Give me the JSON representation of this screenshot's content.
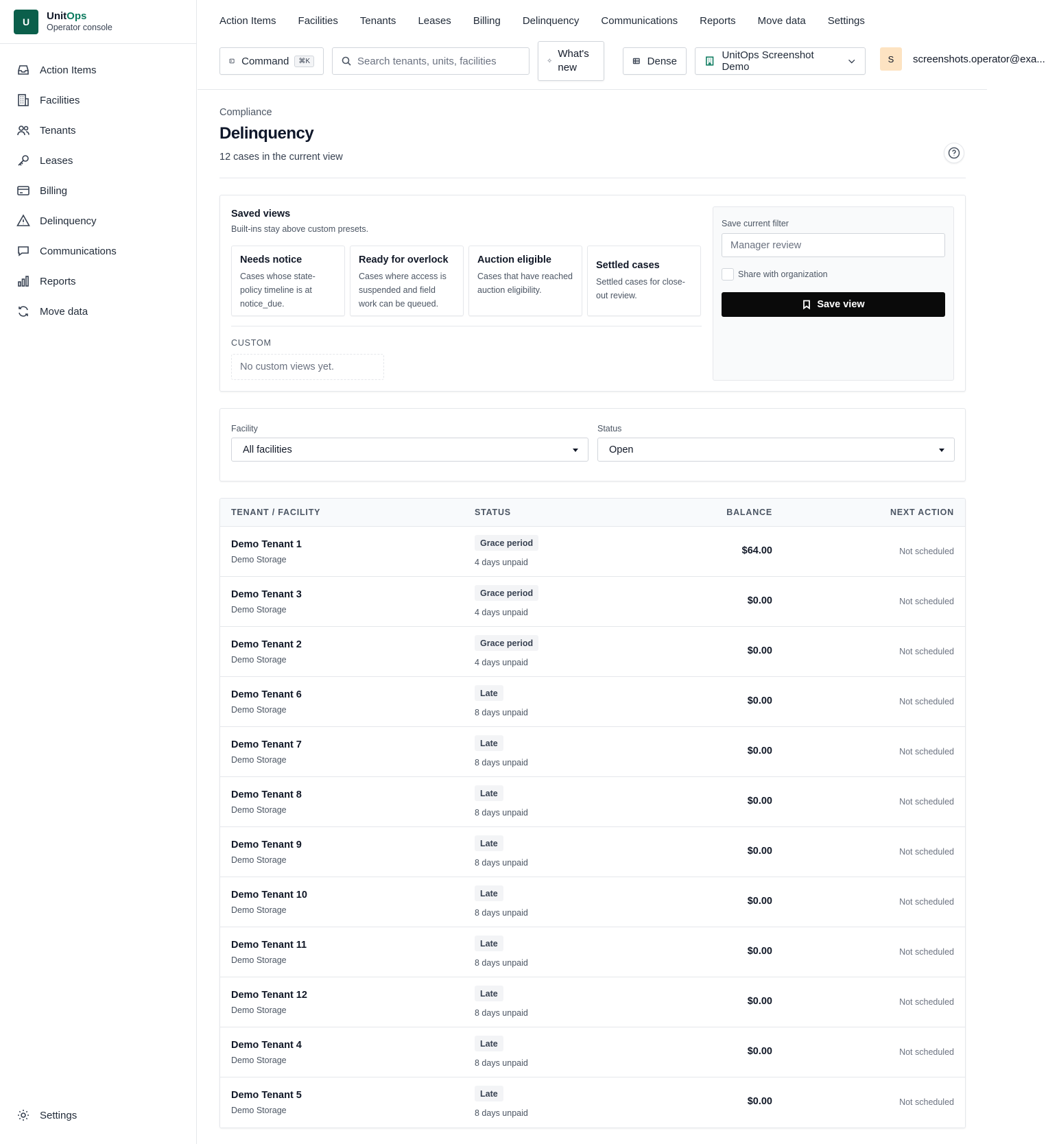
{
  "brand": {
    "logo_letter": "U",
    "name_part1": "Unit",
    "name_part2": "Ops",
    "subtitle": "Operator console"
  },
  "sidebar": {
    "items": [
      {
        "label": "Action Items",
        "icon": "inbox-icon"
      },
      {
        "label": "Facilities",
        "icon": "building-icon"
      },
      {
        "label": "Tenants",
        "icon": "users-icon"
      },
      {
        "label": "Leases",
        "icon": "key-icon"
      },
      {
        "label": "Billing",
        "icon": "credit-card-icon"
      },
      {
        "label": "Delinquency",
        "icon": "warning-icon"
      },
      {
        "label": "Communications",
        "icon": "chat-icon"
      },
      {
        "label": "Reports",
        "icon": "bar-chart-icon"
      },
      {
        "label": "Move data",
        "icon": "sync-icon"
      }
    ],
    "settings_label": "Settings"
  },
  "topnav": {
    "links": [
      "Action Items",
      "Facilities",
      "Tenants",
      "Leases",
      "Billing",
      "Delinquency",
      "Communications",
      "Reports",
      "Move data",
      "Settings"
    ],
    "command_label": "Command",
    "command_shortcut": "⌘K",
    "search_placeholder": "Search tenants, units, facilities",
    "whats_new_label": "What's new",
    "dense_label": "Dense",
    "org_label": "UnitOps Screenshot Demo",
    "avatar_letter": "S",
    "user_email": "screenshots.operator@exa..."
  },
  "page": {
    "eyebrow": "Compliance",
    "title": "Delinquency",
    "subtitle": "12 cases in the current view"
  },
  "saved_views": {
    "title": "Saved views",
    "subtitle": "Built-ins stay above custom presets.",
    "presets": [
      {
        "name": "Needs notice",
        "description": "Cases whose state-policy timeline is at notice_due."
      },
      {
        "name": "Ready for overlock",
        "description": "Cases where access is suspended and field work can be queued."
      },
      {
        "name": "Auction eligible",
        "description": "Cases that have reached auction eligibility."
      },
      {
        "name": "Settled cases",
        "description": "Settled cases for close-out review."
      }
    ],
    "custom_label": "CUSTOM",
    "custom_empty": "No custom views yet.",
    "save_filter_label": "Save current filter",
    "save_filter_placeholder": "Manager review",
    "share_label": "Share with organization",
    "save_button": "Save view"
  },
  "filters": {
    "facility_label": "Facility",
    "facility_value": "All facilities",
    "status_label": "Status",
    "status_value": "Open"
  },
  "table": {
    "columns": [
      "TENANT / FACILITY",
      "STATUS",
      "BALANCE",
      "NEXT ACTION"
    ],
    "rows": [
      {
        "tenant": "Demo Tenant 1",
        "facility": "Demo Storage",
        "status": "Grace period",
        "unpaid": "4 days unpaid",
        "balance": "$64.00",
        "next_action": "Not scheduled"
      },
      {
        "tenant": "Demo Tenant 3",
        "facility": "Demo Storage",
        "status": "Grace period",
        "unpaid": "4 days unpaid",
        "balance": "$0.00",
        "next_action": "Not scheduled"
      },
      {
        "tenant": "Demo Tenant 2",
        "facility": "Demo Storage",
        "status": "Grace period",
        "unpaid": "4 days unpaid",
        "balance": "$0.00",
        "next_action": "Not scheduled"
      },
      {
        "tenant": "Demo Tenant 6",
        "facility": "Demo Storage",
        "status": "Late",
        "unpaid": "8 days unpaid",
        "balance": "$0.00",
        "next_action": "Not scheduled"
      },
      {
        "tenant": "Demo Tenant 7",
        "facility": "Demo Storage",
        "status": "Late",
        "unpaid": "8 days unpaid",
        "balance": "$0.00",
        "next_action": "Not scheduled"
      },
      {
        "tenant": "Demo Tenant 8",
        "facility": "Demo Storage",
        "status": "Late",
        "unpaid": "8 days unpaid",
        "balance": "$0.00",
        "next_action": "Not scheduled"
      },
      {
        "tenant": "Demo Tenant 9",
        "facility": "Demo Storage",
        "status": "Late",
        "unpaid": "8 days unpaid",
        "balance": "$0.00",
        "next_action": "Not scheduled"
      },
      {
        "tenant": "Demo Tenant 10",
        "facility": "Demo Storage",
        "status": "Late",
        "unpaid": "8 days unpaid",
        "balance": "$0.00",
        "next_action": "Not scheduled"
      },
      {
        "tenant": "Demo Tenant 11",
        "facility": "Demo Storage",
        "status": "Late",
        "unpaid": "8 days unpaid",
        "balance": "$0.00",
        "next_action": "Not scheduled"
      },
      {
        "tenant": "Demo Tenant 12",
        "facility": "Demo Storage",
        "status": "Late",
        "unpaid": "8 days unpaid",
        "balance": "$0.00",
        "next_action": "Not scheduled"
      },
      {
        "tenant": "Demo Tenant 4",
        "facility": "Demo Storage",
        "status": "Late",
        "unpaid": "8 days unpaid",
        "balance": "$0.00",
        "next_action": "Not scheduled"
      },
      {
        "tenant": "Demo Tenant 5",
        "facility": "Demo Storage",
        "status": "Late",
        "unpaid": "8 days unpaid",
        "balance": "$0.00",
        "next_action": "Not scheduled"
      }
    ]
  },
  "colors": {
    "brand": "#0b5f4b",
    "brand_accent": "#0b7a5e",
    "primary_button": "#0a0a0a",
    "avatar_bg": "#fde3c2"
  }
}
